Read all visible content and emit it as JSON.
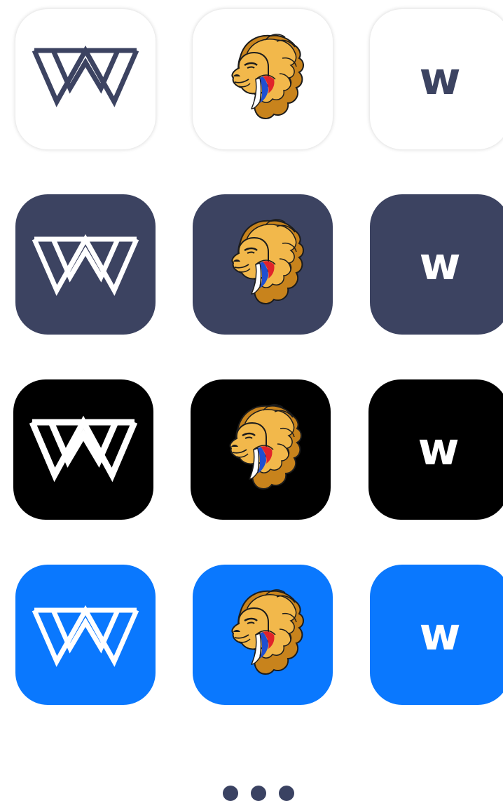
{
  "rows": [
    {
      "name": "white",
      "background": "#ffffff",
      "foreground": "#3c4361",
      "has_shadow": true,
      "tiles": [
        {
          "kind": "w-monogram",
          "icon": "w-monogram-logo-icon"
        },
        {
          "kind": "lion",
          "icon": "lion-head-logo-icon"
        },
        {
          "kind": "letter",
          "letter": "w"
        }
      ]
    },
    {
      "name": "navy",
      "background": "#3c4361",
      "foreground": "#ffffff",
      "has_shadow": false,
      "tiles": [
        {
          "kind": "w-monogram",
          "icon": "w-monogram-logo-icon"
        },
        {
          "kind": "lion",
          "icon": "lion-head-logo-icon"
        },
        {
          "kind": "letter",
          "letter": "w"
        }
      ]
    },
    {
      "name": "black",
      "background": "#000000",
      "foreground": "#ffffff",
      "has_shadow": false,
      "tiles": [
        {
          "kind": "w-monogram",
          "icon": "w-monogram-logo-icon"
        },
        {
          "kind": "lion",
          "icon": "lion-head-logo-icon"
        },
        {
          "kind": "letter",
          "letter": "w"
        }
      ]
    },
    {
      "name": "blue",
      "background": "#0a78fe",
      "foreground": "#ffffff",
      "has_shadow": false,
      "tiles": [
        {
          "kind": "w-monogram",
          "icon": "w-monogram-logo-icon"
        },
        {
          "kind": "lion",
          "icon": "lion-head-logo-icon"
        },
        {
          "kind": "letter",
          "letter": "w"
        }
      ]
    }
  ],
  "colors": {
    "lion_mane": "#f2b84b",
    "lion_mane_dark": "#c8831c",
    "lion_outline": "#1c1c1c",
    "flag_white": "#ffffff",
    "flag_blue": "#1f4fd1",
    "flag_red": "#e0232a",
    "dot": "#3a4262"
  },
  "pagination": {
    "dots": 3,
    "icon": "more-dots-icon"
  }
}
